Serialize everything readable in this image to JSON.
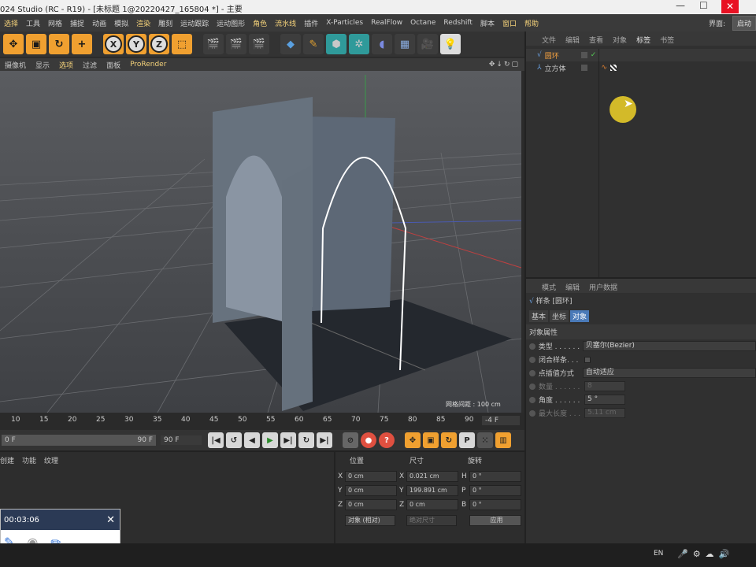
{
  "title": {
    "text": "024 Studio (RC - R19) - [未标题 1@20220427_165804 *] - 主要",
    "min": "—",
    "max": "☐",
    "close": "✕"
  },
  "menu": [
    "选择",
    "工具",
    "网格",
    "捕捉",
    "动画",
    "模拟",
    "渲染",
    "雕刻",
    "运动跟踪",
    "运动图形",
    "角色",
    "流水线",
    "插件",
    "X-Particles",
    "RealFlow",
    "Octane",
    "Redshift",
    "脚本",
    "窗口",
    "帮助"
  ],
  "menu_right": {
    "label": "界面:",
    "value": "启动"
  },
  "toolbar": {
    "x": "X",
    "y": "Y",
    "z": "Z"
  },
  "viewport_menu": [
    "摄像机",
    "显示",
    "选项",
    "过滤",
    "面板",
    "ProRender"
  ],
  "viewport_grid": "网格间距 : 100 cm",
  "obj_tabs": [
    "文件",
    "编辑",
    "查看",
    "对象",
    "标签",
    "书签"
  ],
  "objects": [
    {
      "name": "圆环"
    },
    {
      "name": "立方体"
    }
  ],
  "attr_tabs": [
    "模式",
    "编辑",
    "用户数据"
  ],
  "attr_title": "样条 [圆环]",
  "attr_subtabs": [
    "基本",
    "坐标",
    "对象"
  ],
  "attr_section": "对象属性",
  "props": [
    {
      "label": "类型 . . . . . .",
      "value": "贝塞尔(Bezier)"
    },
    {
      "label": "闭合样条. . .",
      "value": ""
    },
    {
      "label": "点插值方式",
      "value": "自动适应"
    },
    {
      "label": "数量 . . . . . .",
      "value": "8"
    },
    {
      "label": "角度 . . . . . .",
      "value": "5 °"
    },
    {
      "label": "最大长度 . . .",
      "value": "5.11 cm"
    }
  ],
  "timeline_ticks": [
    "10",
    "15",
    "20",
    "25",
    "30",
    "35",
    "40",
    "45",
    "50",
    "55",
    "60",
    "65",
    "70",
    "75",
    "80",
    "85",
    "90"
  ],
  "timeline_frame": "-4 F",
  "playbar": {
    "start": "0 F",
    "end": "90 F",
    "end2": "90 F"
  },
  "bottom_tabs": [
    "创建",
    "功能",
    "纹理"
  ],
  "coord_heads": {
    "pos": "位置",
    "size": "尺寸",
    "rot": "旋转"
  },
  "coords": {
    "px": "0 cm",
    "py": "0 cm",
    "pz": "0 cm",
    "sx": "0.021 cm",
    "sy": "199.891 cm",
    "sz": "0 cm",
    "rh": "0 °",
    "rp": "0 °",
    "rb": "0 °"
  },
  "coord_mode": "对象 (相对)",
  "coord_size_mode": "绝对尺寸",
  "apply": "应用",
  "recorder": {
    "time": "00:03:06"
  },
  "taskbar": {
    "lang": "EN"
  },
  "colors": {
    "accent": "#f0a030",
    "select": "#4a7ab8"
  }
}
